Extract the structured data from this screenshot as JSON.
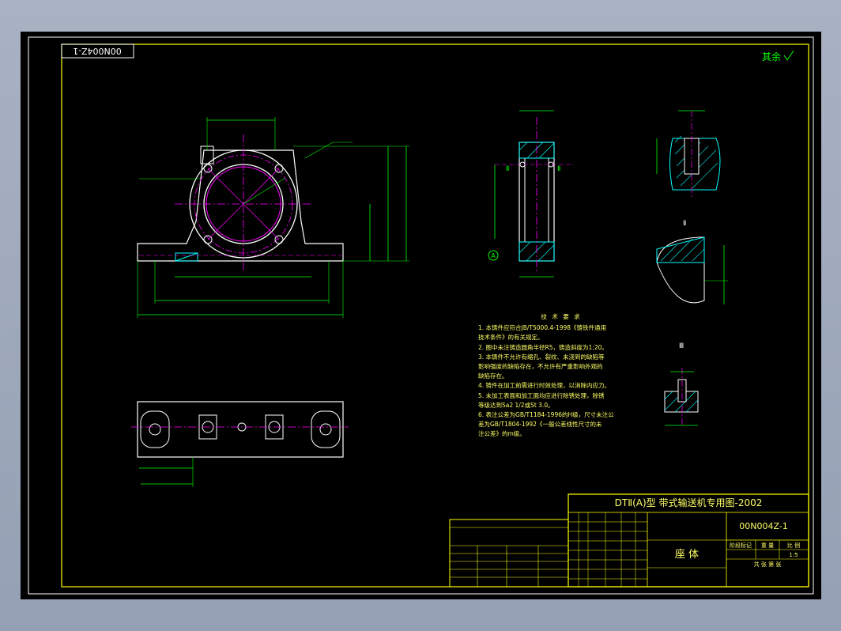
{
  "colors": {
    "background": "#000000",
    "border": "#ffff00",
    "geometry": "#ffffff",
    "dimension": "#00ff00",
    "centerline": "#ff00ff",
    "hatch": "#00ffff",
    "title_text": "#ffff66"
  },
  "sheet": {
    "drawing_no_mirrored": "00N004Z-1",
    "surface_finish_note": "其余"
  },
  "title_block": {
    "series_title": "DTⅡ(A)型  带式输送机专用图-2002",
    "drawing_no": "00N004Z-1",
    "part_name": "座   体",
    "material_label": "阶段标记",
    "weight_label": "重 量",
    "scale_label": "比 例",
    "scale_value": "1:5",
    "sheet_label": "共   张  第   张"
  },
  "technical_requirements": {
    "title": "技 术 要 求",
    "items": [
      "1. 本铸件应符合JB/T5000.4-1998《铸铁件通用",
      "   技术条件》的有关规定。",
      "2. 图中未注铸造圆角半径R5，铸造斜度为1:20。",
      "3. 本铸件不允许有缩孔、裂纹、未浇到的缺陷等",
      "   影响强度的缺陷存在，不允许有严重影响外观的",
      "   缺陷存在。",
      "4. 铸件在加工前需进行时效处理，以消除内应力。",
      "5. 未加工表面和加工面均应进行除锈处理，除锈",
      "   等级达到Sa2 1/2或St 3.0。",
      "6. 表注公差为GB/T1184-1996的H级，尺寸未注公",
      "   差为GB/T1804-1992《一般公差线性尺寸的未",
      "   注公差》的m级。"
    ]
  },
  "section_labels": {
    "section_II": "Ⅱ",
    "section_III": "Ⅲ",
    "datum_A": "A"
  }
}
